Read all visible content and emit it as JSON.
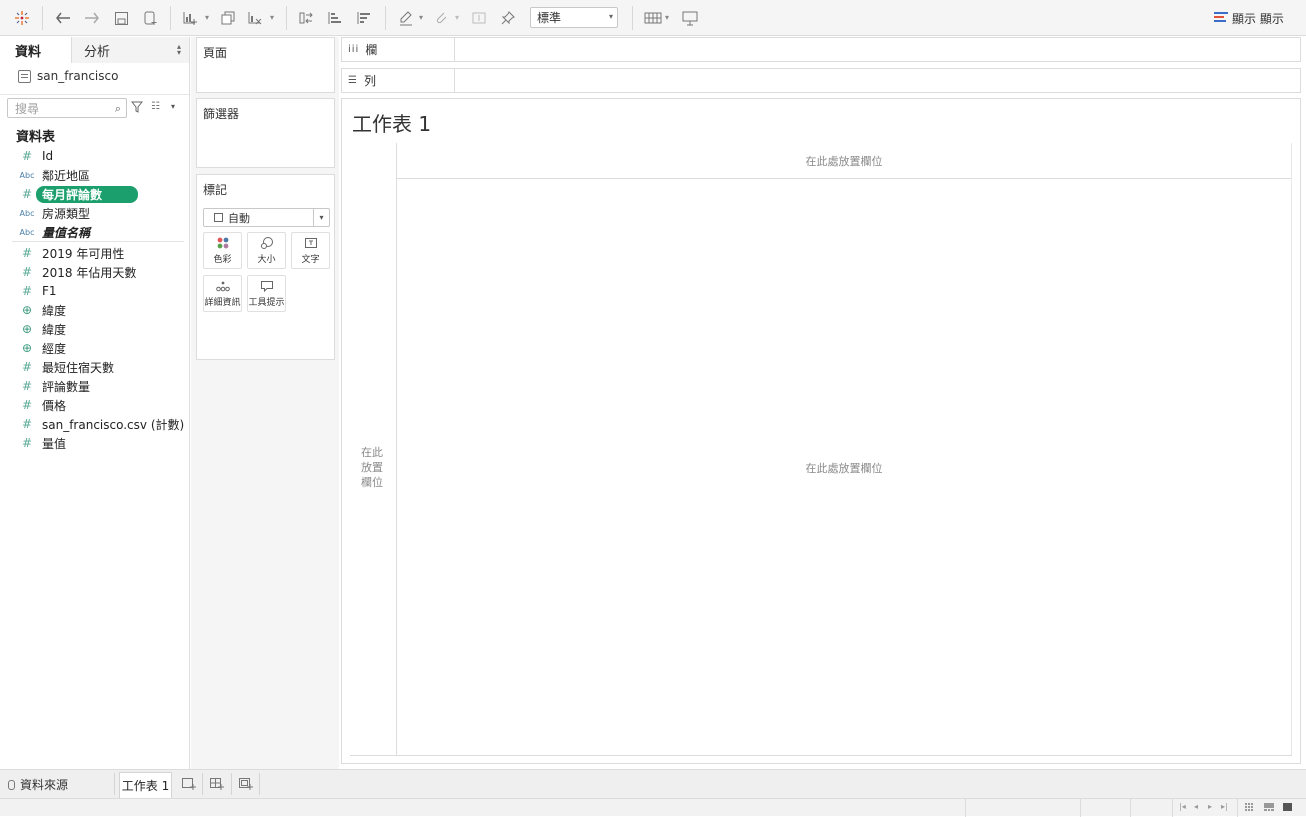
{
  "toolbar": {
    "fit_value": "標準",
    "show_me_label": "顯示 顯示",
    "icons": [
      "tableau-logo-icon",
      "undo-icon",
      "redo-icon",
      "save-icon",
      "add-datasource-icon",
      "new-worksheet-icon",
      "duplicate-sheet-icon",
      "clear-sheet-icon",
      "swap-icon",
      "sort-ascending-icon",
      "sort-descending-icon",
      "highlight-icon",
      "group-icon",
      "labels-icon",
      "pin-icon",
      "fit-icon",
      "presentation-icon"
    ],
    "accent": "#3a6ec8"
  },
  "data_pane": {
    "tab_data": "資料",
    "tab_analysis": "分析",
    "datasource": "san_francisco",
    "search_placeholder": "搜尋",
    "tables_heading": "資料表",
    "fields": [
      {
        "type": "#",
        "name": "Id"
      },
      {
        "type": "Abc",
        "name": "鄰近地區"
      },
      {
        "type": "#",
        "name": "每月評論數"
      },
      {
        "type": "Abc",
        "name": "房源類型"
      },
      {
        "type": "Abc",
        "name": "量值名稱"
      },
      {
        "type": "#",
        "name": "2019 年可用性"
      },
      {
        "type": "#",
        "name": "2018 年佔用天數"
      },
      {
        "type": "#",
        "name": "F1"
      },
      {
        "type": "globe",
        "name": "緯度"
      },
      {
        "type": "globe",
        "name": "緯度"
      },
      {
        "type": "globe",
        "name": "經度"
      },
      {
        "type": "#",
        "name": "最短住宿天數"
      },
      {
        "type": "#",
        "name": "評論數量"
      },
      {
        "type": "#",
        "name": "價格"
      },
      {
        "type": "#",
        "name": "san_francisco.csv (計數)"
      },
      {
        "type": "#",
        "name": "量值"
      }
    ],
    "selected_color": "#1b9f6c"
  },
  "shelves": {
    "pages": "頁面",
    "filters": "篩選器",
    "marks": "標記",
    "mark_type": "自動",
    "mark_buttons": {
      "color": "色彩",
      "size": "大小",
      "text": "文字",
      "detail": "詳細資訊",
      "tooltip": "工具提示"
    },
    "columns_label": "欄",
    "rows_label": "列"
  },
  "view": {
    "title": "工作表 1",
    "drop_top": "在此處放置欄位",
    "drop_left": [
      "在此",
      "放置",
      "欄位"
    ],
    "drop_center": "在此處放置欄位"
  },
  "bottom_tabs": {
    "datasource_tab": "資料來源",
    "sheet_tab": "工作表 1"
  }
}
